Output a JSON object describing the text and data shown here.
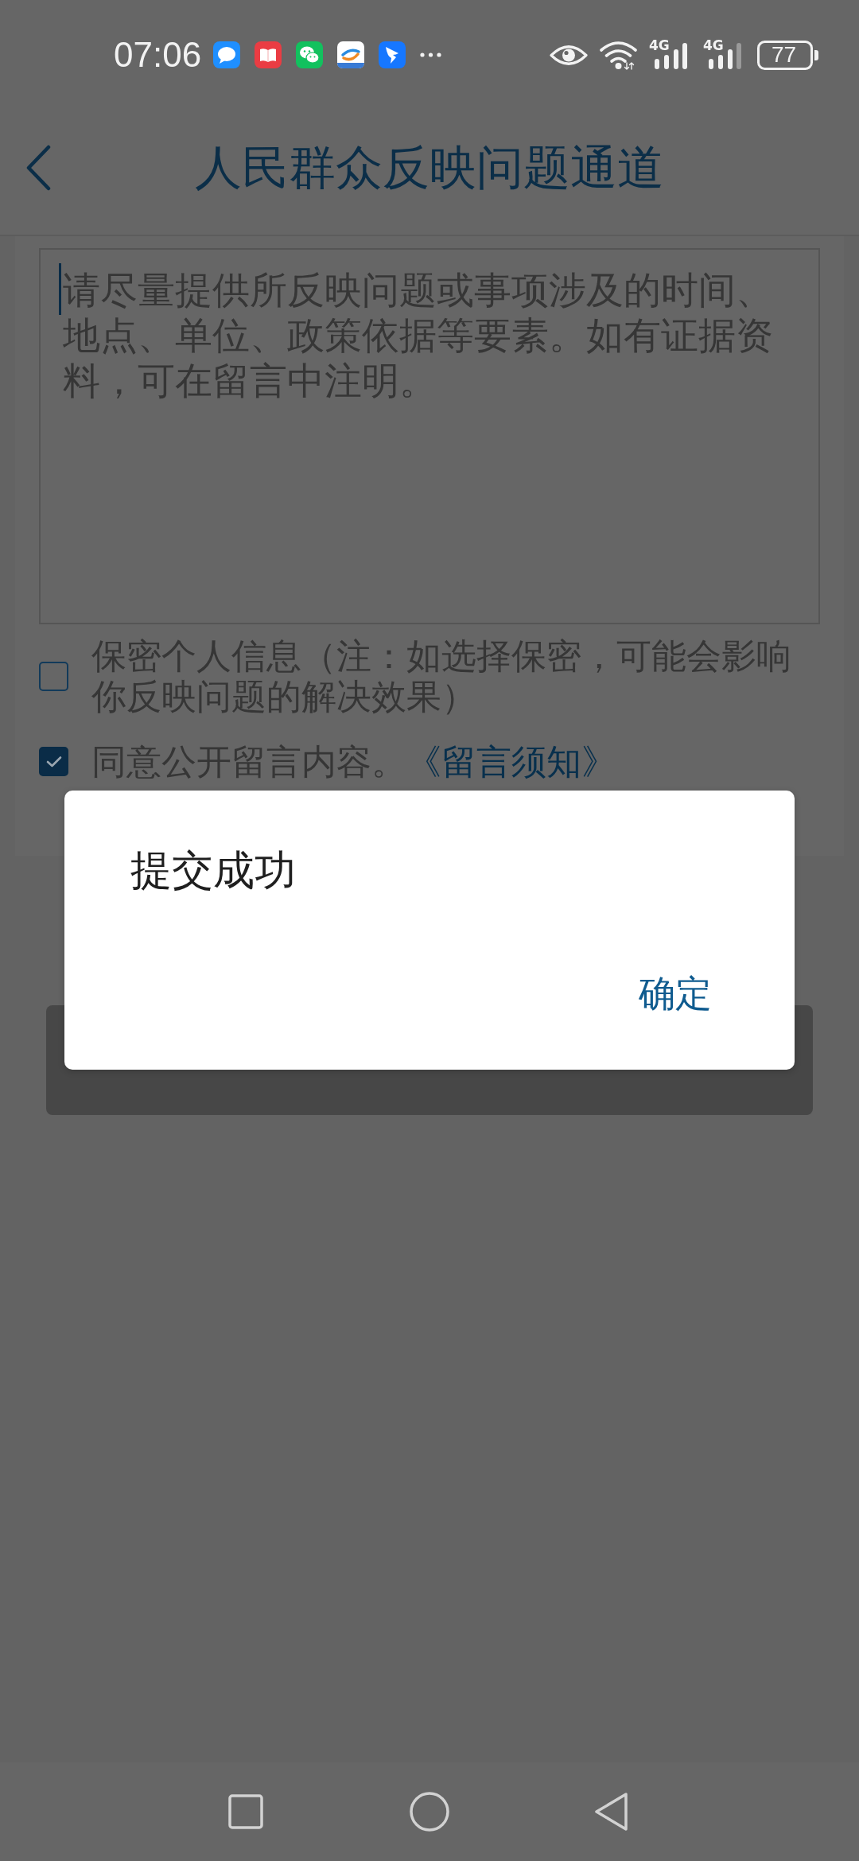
{
  "status_bar": {
    "time": "07:06",
    "networks": [
      {
        "type": "4G"
      },
      {
        "type": "4G"
      }
    ],
    "battery": "77"
  },
  "header": {
    "title": "人民群众反映问题通道"
  },
  "form": {
    "message_field": {
      "placeholder": "请尽量提供所反映问题或事项涉及的时间、地点、单位、政策依据等要素。如有证据资料，可在留言中注明。"
    },
    "options": [
      {
        "label": "保密个人信息（注：如选择保密，可能会影响你反映问题的解决效果）",
        "checked": false
      },
      {
        "label": "同意公开留言内容。",
        "link": "《留言须知》",
        "checked": true
      }
    ]
  },
  "dialog": {
    "message": "提交成功",
    "buttons": [
      "确定"
    ]
  }
}
